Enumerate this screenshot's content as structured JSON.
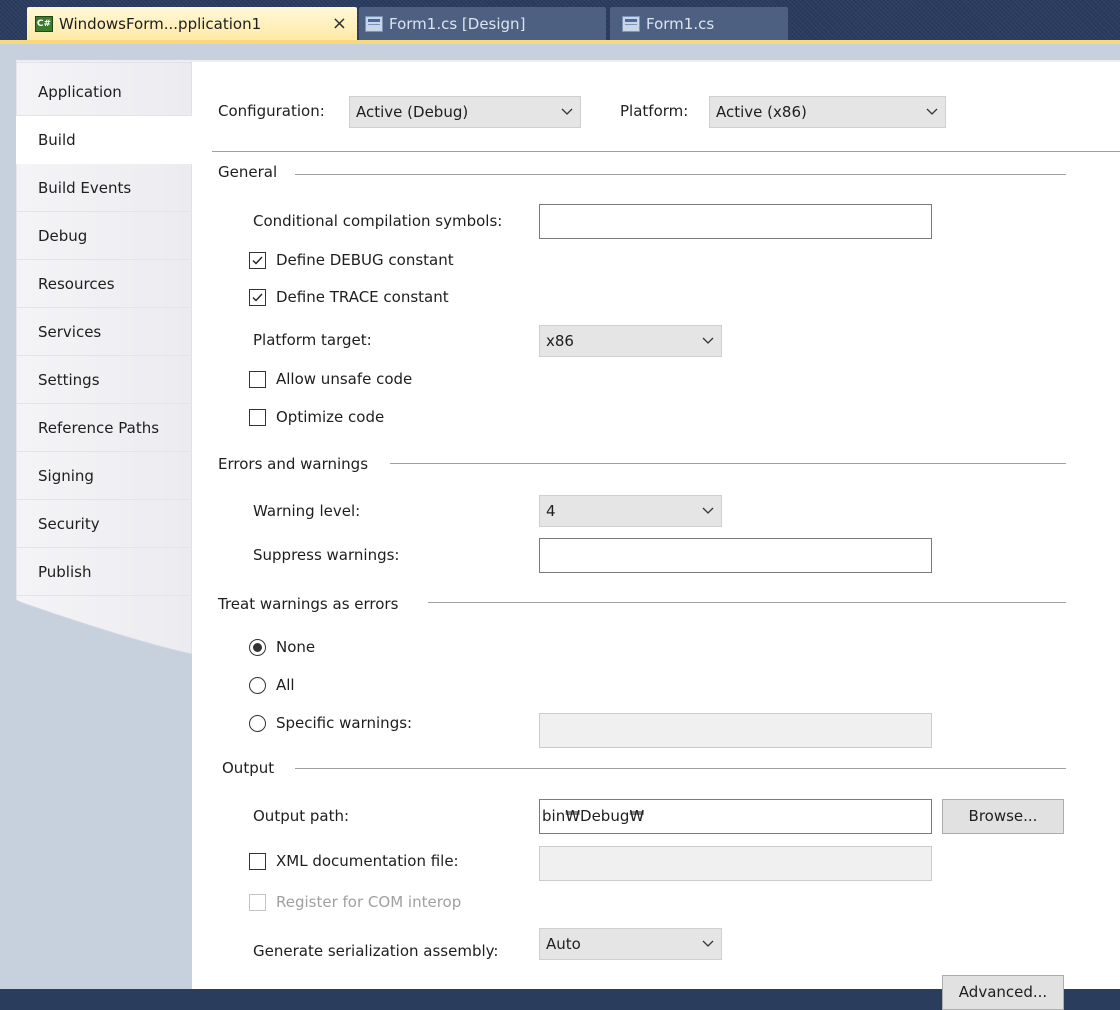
{
  "doc_tabs": [
    {
      "label": "WindowsForm...pplication1",
      "icon": "csharp-project-icon",
      "close": "×"
    },
    {
      "label": "Form1.cs [Design]",
      "icon": "form-designer-icon"
    },
    {
      "label": "Form1.cs",
      "icon": "form-code-icon"
    }
  ],
  "nav": {
    "items": [
      "Application",
      "Build",
      "Build Events",
      "Debug",
      "Resources",
      "Services",
      "Settings",
      "Reference Paths",
      "Signing",
      "Security",
      "Publish"
    ],
    "active": "Build"
  },
  "header": {
    "configuration_label": "Configuration:",
    "configuration_value": "Active (Debug)",
    "platform_label": "Platform:",
    "platform_value": "Active (x86)"
  },
  "general": {
    "title": "General",
    "cond_symbols_label": "Conditional compilation symbols:",
    "cond_symbols_value": "",
    "define_debug_label": "Define DEBUG constant",
    "define_debug_checked": true,
    "define_trace_label": "Define TRACE constant",
    "define_trace_checked": true,
    "platform_target_label": "Platform target:",
    "platform_target_value": "x86",
    "allow_unsafe_label": "Allow unsafe code",
    "allow_unsafe_checked": false,
    "optimize_label": "Optimize code",
    "optimize_checked": false
  },
  "errors": {
    "title": "Errors and warnings",
    "warning_level_label": "Warning level:",
    "warning_level_value": "4",
    "suppress_label": "Suppress warnings:",
    "suppress_value": ""
  },
  "treat": {
    "title": "Treat warnings as errors",
    "none_label": "None",
    "all_label": "All",
    "specific_label": "Specific warnings:",
    "selected": "None"
  },
  "output": {
    "title": "Output",
    "path_label": "Output path:",
    "path_value": "bin₩Debug₩",
    "browse_label": "Browse...",
    "xml_doc_label": "XML documentation file:",
    "xml_doc_checked": false,
    "com_interop_label": "Register for COM interop",
    "com_interop_checked": false,
    "serialization_label": "Generate serialization assembly:",
    "serialization_value": "Auto",
    "advanced_label": "Advanced..."
  }
}
